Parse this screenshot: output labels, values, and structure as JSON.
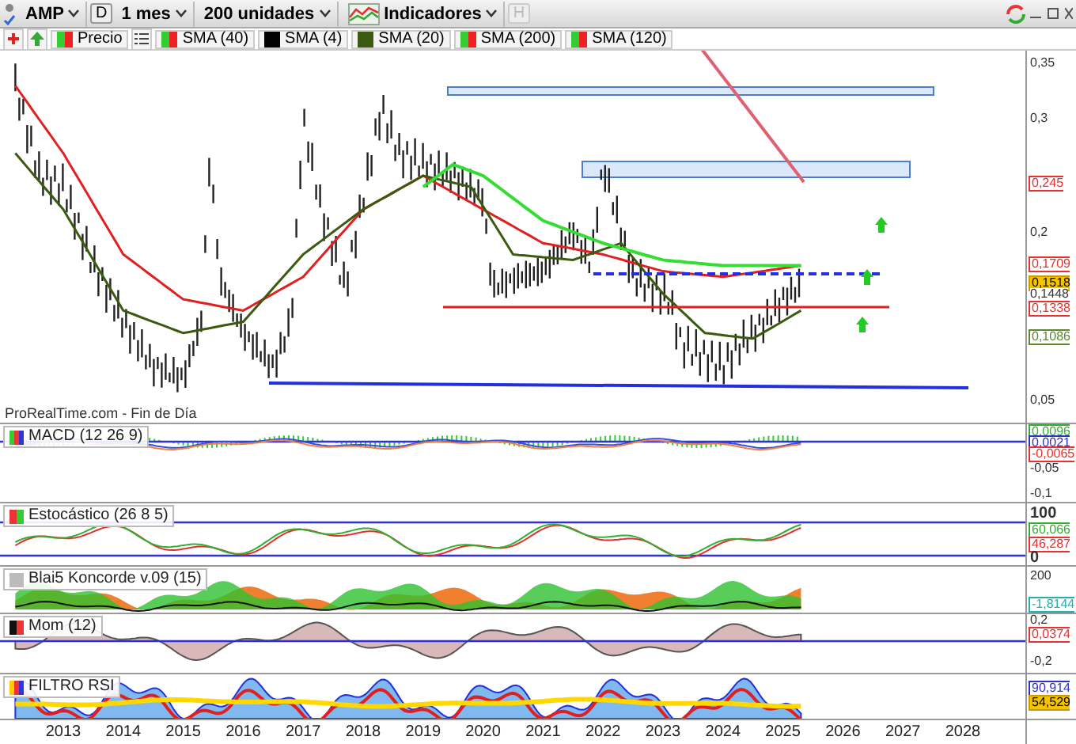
{
  "toolbar": {
    "symbol": "AMP",
    "period_code": "D",
    "timeframe": "1 mes",
    "units": "200 unidades",
    "indicators": "Indicadores",
    "history_code": "H"
  },
  "legend": [
    {
      "label": "Precio",
      "kind": "updown"
    },
    {
      "label": "SMA (40)",
      "kind": "updown"
    },
    {
      "label": "SMA (4)",
      "kind": "solid",
      "color": "#000000"
    },
    {
      "label": "SMA (20)",
      "kind": "solid",
      "color": "#3a5a10"
    },
    {
      "label": "SMA (200)",
      "kind": "updown"
    },
    {
      "label": "SMA (120)",
      "kind": "updown"
    }
  ],
  "main_chart": {
    "source": "ProRealTime.com - Fin de Día",
    "axis": [
      {
        "text": "0,35",
        "kind": "tick"
      },
      {
        "text": "0,3",
        "kind": "tick"
      },
      {
        "text": "0,245",
        "kind": "tag",
        "color": "#e83030"
      },
      {
        "text": "0,2",
        "kind": "tick"
      },
      {
        "text": "0,1709",
        "kind": "tag",
        "color": "#e83030"
      },
      {
        "text": "0,1518",
        "kind": "highlight"
      },
      {
        "text": "0,1448",
        "kind": "tick"
      },
      {
        "text": "0,1338",
        "kind": "tag",
        "color": "#e83030"
      },
      {
        "text": "0,1086",
        "kind": "tag",
        "color": "#5a8a2a"
      },
      {
        "text": "0,05",
        "kind": "tick"
      }
    ]
  },
  "panels": [
    {
      "title": "MACD (12 26 9)",
      "kind": "macd",
      "axis": [
        {
          "text": "0,0096",
          "kind": "tag",
          "color": "#30b030"
        },
        {
          "text": "0,0021",
          "kind": "tag",
          "color": "#3030d0"
        },
        {
          "text": "-0,0065",
          "kind": "tag",
          "color": "#e83030"
        },
        {
          "text": "-0,05",
          "kind": "tick"
        },
        {
          "text": "-0,1",
          "kind": "tick"
        }
      ]
    },
    {
      "title": "Estocástico (26 8 5)",
      "kind": "stochastic",
      "axis": [
        {
          "text": "100",
          "kind": "major"
        },
        {
          "text": "60,066",
          "kind": "tag",
          "color": "#30b030"
        },
        {
          "text": "46,287",
          "kind": "tag",
          "color": "#e83030"
        },
        {
          "text": "0",
          "kind": "major"
        }
      ]
    },
    {
      "title": "Blai5 Koncorde v.09 (15)",
      "kind": "koncorde",
      "axis": [
        {
          "text": "200",
          "kind": "tick"
        },
        {
          "text": "-1,8144",
          "kind": "tag",
          "color": "#20b0b0"
        }
      ]
    },
    {
      "title": "Mom (12)",
      "kind": "momentum",
      "axis": [
        {
          "text": "0,2",
          "kind": "tick"
        },
        {
          "text": "0,0374",
          "kind": "tag",
          "color": "#e83030"
        },
        {
          "text": "-0,2",
          "kind": "tick"
        }
      ]
    },
    {
      "title": "FILTRO RSI",
      "kind": "rsi",
      "axis": [
        {
          "text": "90,914",
          "kind": "tag",
          "color": "#3030d0"
        },
        {
          "text": "54,529",
          "kind": "highlight"
        }
      ]
    }
  ],
  "x_axis": [
    "2013",
    "2014",
    "2015",
    "2016",
    "2017",
    "2018",
    "2019",
    "2020",
    "2021",
    "2022",
    "2023",
    "2024",
    "2025",
    "2026",
    "2027",
    "2028"
  ]
}
